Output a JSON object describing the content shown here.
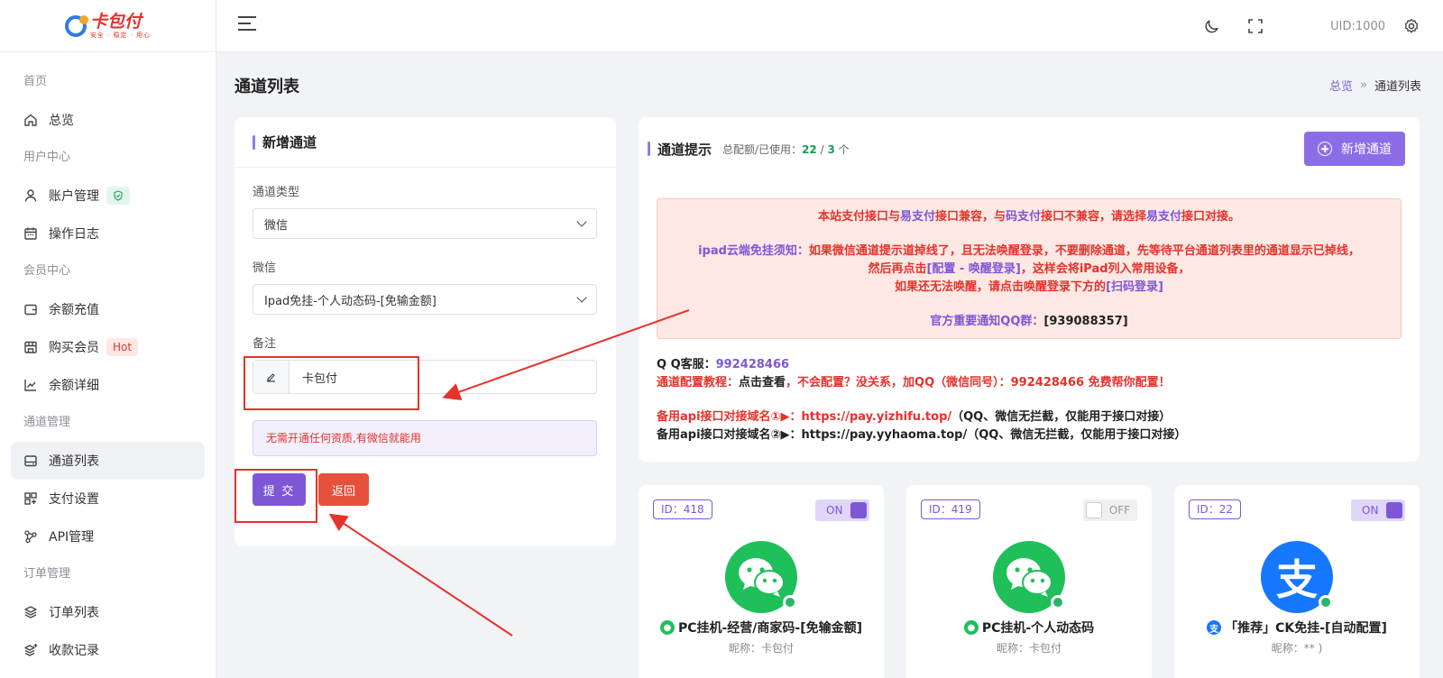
{
  "brand": {
    "name": "卡包付",
    "tagline": "安全 · 稳定 · 用心"
  },
  "sidebar": {
    "sections": [
      {
        "title": "首页",
        "items": [
          {
            "label": "总览",
            "icon": "home-icon"
          }
        ]
      },
      {
        "title": "用户中心",
        "items": [
          {
            "label": "账户管理",
            "icon": "user-icon"
          },
          {
            "label": "操作日志",
            "icon": "calendar-icon"
          }
        ]
      },
      {
        "title": "会员中心",
        "items": [
          {
            "label": "余额充值",
            "icon": "wallet-icon"
          },
          {
            "label": "购买会员",
            "icon": "store-icon",
            "badge": "Hot"
          },
          {
            "label": "余额详细",
            "icon": "chart-line-icon"
          }
        ]
      },
      {
        "title": "通道管理",
        "items": [
          {
            "label": "通道列表",
            "icon": "inbox-icon"
          },
          {
            "label": "支付设置",
            "icon": "grid-plus-icon"
          },
          {
            "label": "API管理",
            "icon": "share-nodes-icon"
          }
        ]
      },
      {
        "title": "订单管理",
        "items": [
          {
            "label": "订单列表",
            "icon": "layers-icon"
          },
          {
            "label": "收款记录",
            "icon": "layers-plus-icon"
          }
        ]
      }
    ]
  },
  "topbar": {
    "uid": "UID:1000"
  },
  "page": {
    "title": "通道列表",
    "breadcrumb": [
      "总览",
      "»",
      "通道列表"
    ]
  },
  "form": {
    "title": "新增通道",
    "type_label": "通道类型",
    "type_value": "微信",
    "sub_label": "微信",
    "sub_value": "Ipad免挂-个人动态码-[免输金额]",
    "remark_label": "备注",
    "remark_value": "卡包付",
    "hint": "无需开通任何资质,有微信就能用",
    "submit": "提 交",
    "back": "返回"
  },
  "info": {
    "title": "通道提示",
    "quota_label": "总配额/已使用：",
    "quota_total": "22",
    "quota_sep": " / ",
    "quota_used": "3",
    "quota_unit": " 个",
    "add_button": "新增通道",
    "alert": {
      "l1a": "本站支付接口与",
      "l1b": "易支付",
      "l1c": "接口兼容，与",
      "l1d": "码支付",
      "l1e": "接口不兼容，请选择",
      "l1f": "易支付",
      "l1g": "接口对接。",
      "l2a": "ipad云端免挂须知：",
      "l2b": "如果微信通道提示道掉线了，且无法唤醒登录，不要删除通道，先等待平台通道列表里的通道显示已掉线，",
      "l3a": "然后再点击",
      "l3b": "[配置 - 唤醒登录]",
      "l3c": "，这样会将iPad列入常用设备，",
      "l4a": "如果还无法唤醒，请点击唤醒登录下方的",
      "l4b": "[扫码登录]",
      "l5a": "官方重要通知QQ群：",
      "l5b": "[939088357]"
    },
    "qq_label": "Q Q客服：",
    "qq_value": "992428466",
    "tutorial_label": "通道配置教程：",
    "tutorial_link": "点击查看",
    "tutorial_rest": "，不会配置？没关系，加QQ（微信同号）：992428466 免费帮你配置！",
    "api1_label": "备用api接口对接域名①▶：",
    "api1_url": "https://pay.yizhifu.top/",
    "api1_note": "（QQ、微信无拦截，仅能用于接口对接）",
    "api2_label": "备用api接口对接域名②▶：",
    "api2_url": "https://pay.yyhaoma.top/",
    "api2_note": "（QQ、微信无拦截，仅能用于接口对接）"
  },
  "channels": [
    {
      "id": "ID：418",
      "toggle": "ON",
      "name": "PC挂机-经营/商家码-[免输金额]",
      "nick": "昵称：卡包付",
      "icon": "wechat-icon"
    },
    {
      "id": "ID：419",
      "toggle": "OFF",
      "name": "PC挂机-个人动态码",
      "nick": "昵称：卡包付",
      "icon": "wechat-icon"
    },
    {
      "id": "ID：22",
      "toggle": "ON",
      "name": "「推荐」CK免挂-[自动配置]",
      "nick": "昵称：** )",
      "icon": "alipay-icon",
      "glyph": "支"
    }
  ],
  "colors": {
    "accent": "#7e57d6",
    "danger": "#e4322b",
    "success": "#1e9b52",
    "wechat": "#1fbf5a",
    "alipay": "#1677ff"
  }
}
